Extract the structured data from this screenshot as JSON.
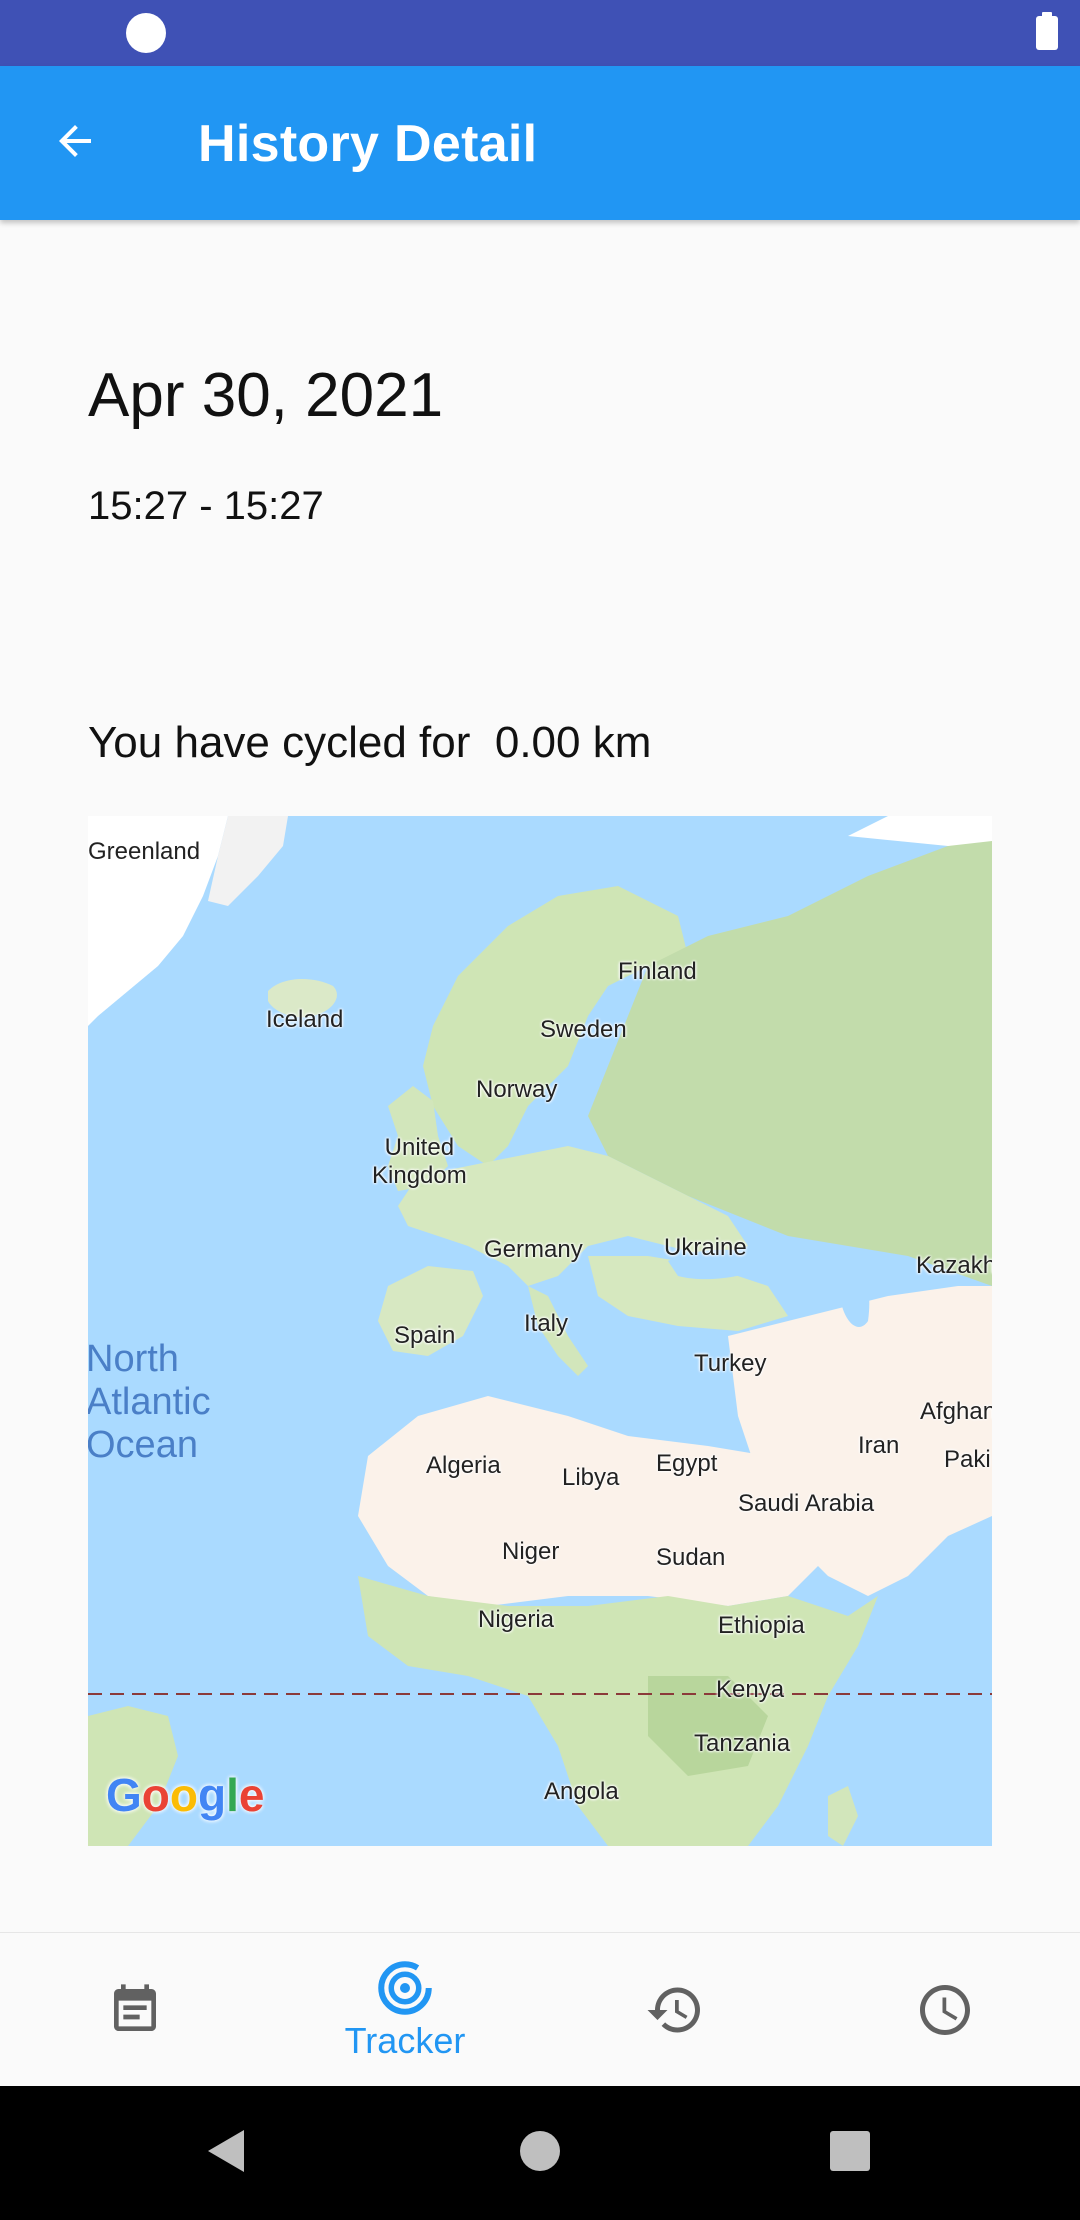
{
  "status_bar": {
    "bg_color": "#3f51b5"
  },
  "app_bar": {
    "title": "History Detail",
    "back_icon": "arrow-back-icon",
    "bg_color": "#2196f3"
  },
  "detail": {
    "date": "Apr 30, 2021",
    "time_range": "15:27 - 15:27",
    "distance_text": "You have cycled for  0.00 km"
  },
  "map": {
    "labels": {
      "greenland": "Greenland",
      "iceland": "Iceland",
      "finland": "Finland",
      "sweden": "Sweden",
      "norway": "Norway",
      "united_kingdom": "United\nKingdom",
      "germany": "Germany",
      "ukraine": "Ukraine",
      "kazakh": "Kazakh",
      "spain": "Spain",
      "italy": "Italy",
      "turkey": "Turkey",
      "afghan": "Afghan",
      "iran": "Iran",
      "paki": "Paki",
      "algeria": "Algeria",
      "libya": "Libya",
      "egypt": "Egypt",
      "saudi_arabia": "Saudi Arabia",
      "niger": "Niger",
      "sudan": "Sudan",
      "nigeria": "Nigeria",
      "ethiopia": "Ethiopia",
      "kenya": "Kenya",
      "tanzania": "Tanzania",
      "angola": "Angola"
    },
    "ocean_label": "North\nAtlantic\nOcean",
    "attribution": "Google",
    "colors": {
      "water": "#aadaff",
      "land_green": "#cfe5b5",
      "land_desert": "#fbf2ea",
      "ice": "#ffffff"
    }
  },
  "bottom_nav": {
    "items": [
      {
        "icon": "calendar-note-icon",
        "label": "",
        "active": false
      },
      {
        "icon": "tracker-radar-icon",
        "label": "Tracker",
        "active": true
      },
      {
        "icon": "history-icon",
        "label": "",
        "active": false
      },
      {
        "icon": "clock-icon",
        "label": "",
        "active": false
      }
    ],
    "active_color": "#2196f3",
    "inactive_color": "#616161"
  },
  "system_nav": {
    "icons": [
      "back-triangle-icon",
      "home-circle-icon",
      "recents-square-icon"
    ]
  }
}
